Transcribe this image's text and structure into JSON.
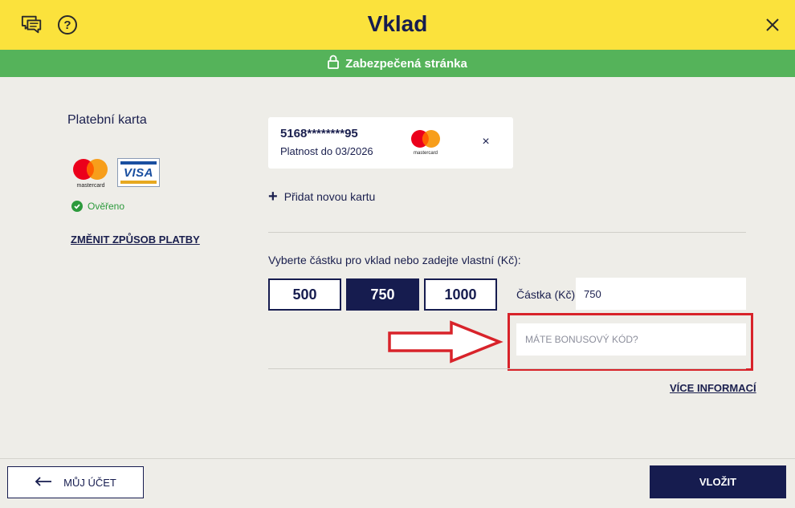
{
  "header": {
    "title": "Vklad",
    "chat_icon": "chat-icon",
    "help_icon": "help-icon",
    "help_glyph": "?",
    "close_icon": "close-icon"
  },
  "secure_bar": {
    "text": "Zabezpečená stránka",
    "icon": "lock-icon"
  },
  "payment": {
    "title": "Platební karta",
    "verified": "Ověřeno",
    "change_link": "ZMĚNIT ZPŮSOB PLATBY",
    "mastercard_label": "mastercard",
    "visa_label": "VISA"
  },
  "saved_card": {
    "number": "5168********95",
    "valid": "Platnost do 03/2026",
    "brand": "mastercard",
    "remove_glyph": "×"
  },
  "add_card": {
    "label": "Přidat novou kartu",
    "plus_glyph": "+"
  },
  "amount": {
    "prompt": "Vyberte částku pro vklad nebo zadejte vlastní (Kč):",
    "options": [
      "500",
      "750",
      "1000"
    ],
    "selected": "750",
    "input_label": "Částka (Kč):",
    "input_value": "750"
  },
  "bonus": {
    "placeholder": "MÁTE BONUSOVÝ KÓD?"
  },
  "more_info": "VÍCE INFORMACÍ",
  "footer": {
    "account_label": "MŮJ ÚČET",
    "submit_label": "VLOŽIT"
  },
  "colors": {
    "header": "#fbe23c",
    "secure": "#55b35a",
    "navy": "#161c4f",
    "highlight": "#d8232a",
    "verified": "#2c9a3c"
  }
}
